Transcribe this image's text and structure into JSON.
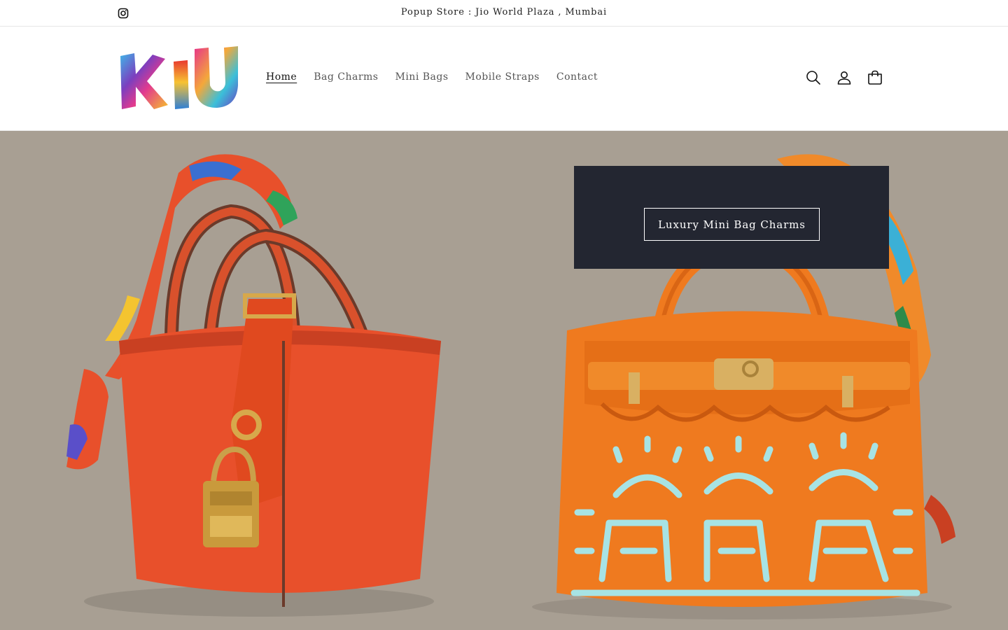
{
  "announcement": {
    "text": "Popup Store : Jio World Plaza , Mumbai",
    "social_icon": "instagram-icon"
  },
  "header": {
    "logo_text": "KIU",
    "nav": [
      {
        "label": "Home",
        "active": true
      },
      {
        "label": "Bag Charms",
        "active": false
      },
      {
        "label": "Mini Bags",
        "active": false
      },
      {
        "label": "Mobile Straps",
        "active": false
      },
      {
        "label": "Contact",
        "active": false
      }
    ],
    "icons": [
      "search-icon",
      "account-icon",
      "cart-icon"
    ]
  },
  "hero": {
    "button_label": "Luxury Mini Bag Charms",
    "background_color": "#a89f93",
    "panel_color": "#232631"
  },
  "colors": {
    "bag_left": "#e8502b",
    "bag_right": "#ef7a1f",
    "paint": "#a7e3e4"
  }
}
